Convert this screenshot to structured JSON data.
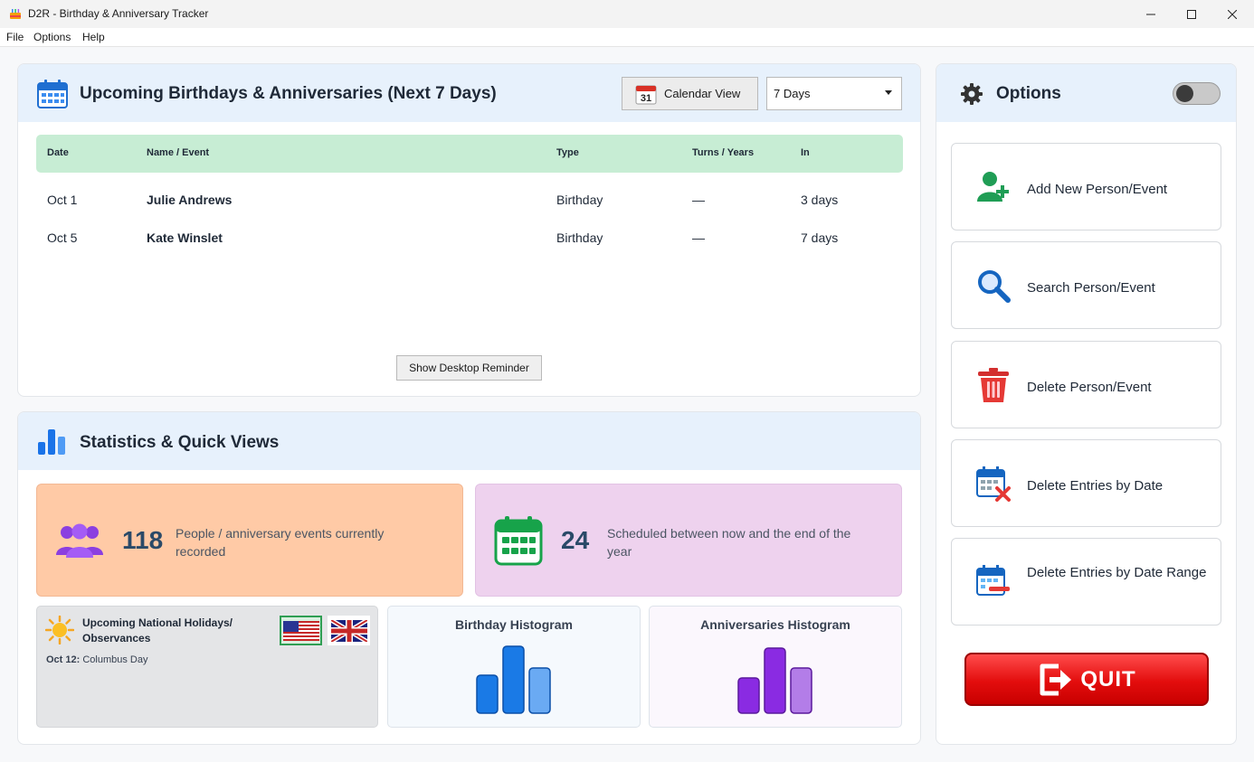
{
  "window": {
    "title": "D2R - Birthday & Anniversary Tracker"
  },
  "menu": [
    "File",
    "Options",
    "Help"
  ],
  "upcoming": {
    "title": "Upcoming Birthdays & Anniversaries (Next 7 Days)",
    "calendar_button": "Calendar View",
    "calendar_icon_day": "31",
    "range_selected": "7 Days",
    "columns": [
      "Date",
      "Name / Event",
      "Type",
      "Turns / Years",
      "In"
    ],
    "rows": [
      {
        "date": "Oct 1",
        "name": "Julie Andrews",
        "type": "Birthday",
        "turns": "—",
        "in": "3 days"
      },
      {
        "date": "Oct 5",
        "name": "Kate Winslet",
        "type": "Birthday",
        "turns": "—",
        "in": "7 days"
      }
    ],
    "reminder_button": "Show Desktop Reminder"
  },
  "stats": {
    "title": "Statistics & Quick Views",
    "people_count": "118",
    "people_text": "People / anniversary events currently recorded",
    "scheduled_count": "24",
    "scheduled_text": "Scheduled between now and the end of the year",
    "holidays": {
      "title": "Upcoming National Holidays/ Observances",
      "date": "Oct 12:",
      "name": "Columbus Day"
    },
    "birthday_histogram": "Birthday Histogram",
    "anniversaries_histogram": "Anniversaries Histogram"
  },
  "options": {
    "title": "Options",
    "buttons": {
      "add": "Add New Person/Event",
      "search": "Search Person/Event",
      "delete": "Delete Person/Event",
      "delete_by_date": "Delete Entries by Date",
      "delete_by_range": "Delete Entries by Date Range"
    },
    "quit": "QUIT"
  },
  "colors": {
    "accent_blue": "#1677e6",
    "header_bg": "#e7f1fc",
    "table_head": "#c7edd4",
    "card_orange": "#ffcaa6",
    "card_purple": "#eed2ee",
    "quit_red": "#e30d0d"
  },
  "icons": [
    "app-icon",
    "calendar-icon",
    "bar-chart-icon",
    "gear-icon",
    "people-icon",
    "calendar-grid-icon",
    "sun-icon",
    "us-flag-icon",
    "uk-flag-icon",
    "add-user-icon",
    "search-icon",
    "trash-icon",
    "calendar-delete-icon",
    "calendar-range-icon",
    "exit-icon"
  ]
}
